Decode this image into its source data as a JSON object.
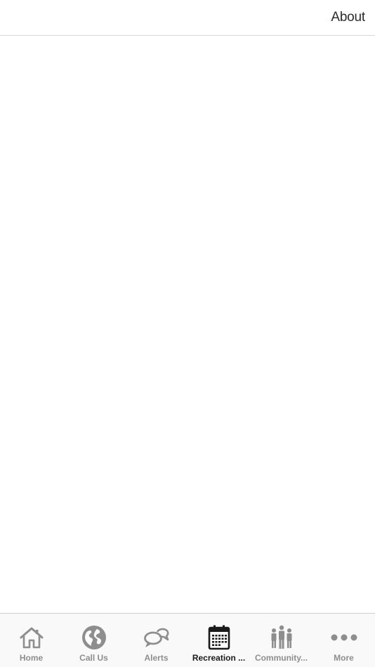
{
  "header": {
    "right_action_label": "About"
  },
  "tabbar": {
    "active_index": 3,
    "items": [
      {
        "label": "Home",
        "icon": "home-icon"
      },
      {
        "label": "Call Us",
        "icon": "globe-icon"
      },
      {
        "label": "Alerts",
        "icon": "chat-bubbles-icon"
      },
      {
        "label": "Recreation ...",
        "icon": "calendar-icon"
      },
      {
        "label": "Community...",
        "icon": "people-icon"
      },
      {
        "label": "More",
        "icon": "more-dots-icon"
      }
    ]
  },
  "colors": {
    "inactive": "#8e8e8e",
    "active": "#1a1a1a",
    "tabbar_bg": "#f9f9f9",
    "divider": "#d6d6d6"
  }
}
